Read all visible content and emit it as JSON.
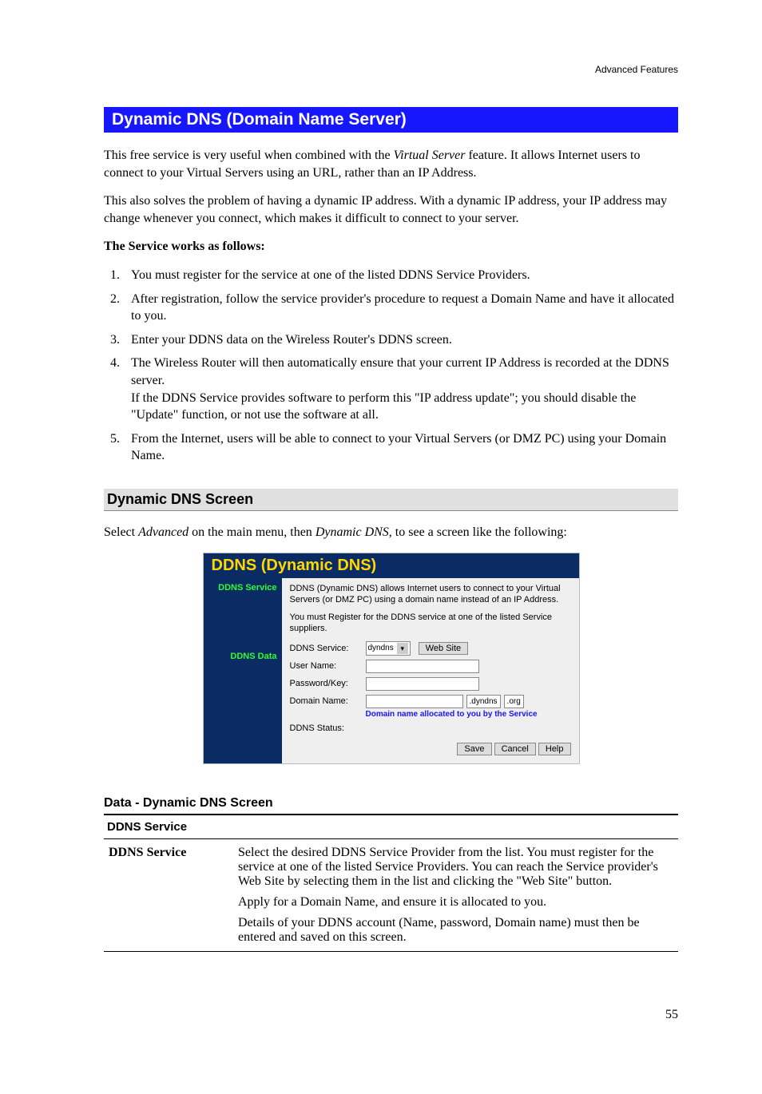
{
  "header": {
    "section": "Advanced Features"
  },
  "h1": "Dynamic DNS (Domain Name Server)",
  "intro": {
    "p1_pre": "This free service is very useful when combined with the ",
    "p1_em": "Virtual Server",
    "p1_post": " feature. It allows Internet users to connect to your Virtual Servers using an URL, rather than an IP Address.",
    "p2": "This also solves the problem of having a dynamic IP address. With a dynamic IP address, your IP address may change whenever you connect, which makes it difficult to connect to your server.",
    "works_heading": "The Service works as follows:"
  },
  "steps": [
    "You must register for the service at one of the listed DDNS Service Providers.",
    "After registration, follow the service provider's procedure to request a Domain Name and have it allocated to you.",
    "Enter your DDNS data on the Wireless Router's DDNS screen.",
    "The Wireless Router will then automatically ensure that your current IP Address is recorded at the DDNS server.\nIf the DDNS Service provides software to perform this \"IP address update\"; you should disable the \"Update\" function, or not use the software at all.",
    "From the Internet, users will be able to connect to your Virtual Servers (or DMZ PC) using your Domain Name."
  ],
  "h2": "Dynamic DNS Screen",
  "nav_line": {
    "pre": "Select ",
    "em1": "Advanced",
    "mid": " on the main menu, then ",
    "em2": "Dynamic DNS",
    "post": ", to see a screen like the following:"
  },
  "shot": {
    "title": "DDNS (Dynamic DNS)",
    "side1": "DDNS Service",
    "side2": "DDNS Data",
    "desc1": "DDNS (Dynamic DNS) allows Internet users to connect to your Virtual Servers (or DMZ PC) using a domain name instead of an IP Address.",
    "desc2": "You must Register for the DDNS service at one of the listed Service suppliers.",
    "labels": {
      "service": "DDNS Service:",
      "user": "User Name:",
      "pass": "Password/Key:",
      "domain": "Domain Name:",
      "status": "DDNS Status:"
    },
    "service_value": "dyndns",
    "domain_parts": {
      "a": "dyndns",
      "b": "org"
    },
    "hint": "Domain name allocated to you by the Service",
    "buttons": {
      "website": "Web Site",
      "save": "Save",
      "cancel": "Cancel",
      "help": "Help"
    }
  },
  "data_heading": "Data - Dynamic DNS Screen",
  "table": {
    "section": "DDNS Service",
    "row_key": "DDNS Service",
    "row_value": {
      "p1": "Select the desired DDNS Service Provider from the list. You must register for the service at one of the listed Service Providers. You can reach the Service provider's Web Site by selecting them in the list and clicking the \"Web Site\" button.",
      "p2": "Apply for a Domain Name, and ensure it is allocated to you.",
      "p3": "Details of your DDNS account (Name, password, Domain name) must then be entered and saved on this screen."
    }
  },
  "page_number": "55"
}
